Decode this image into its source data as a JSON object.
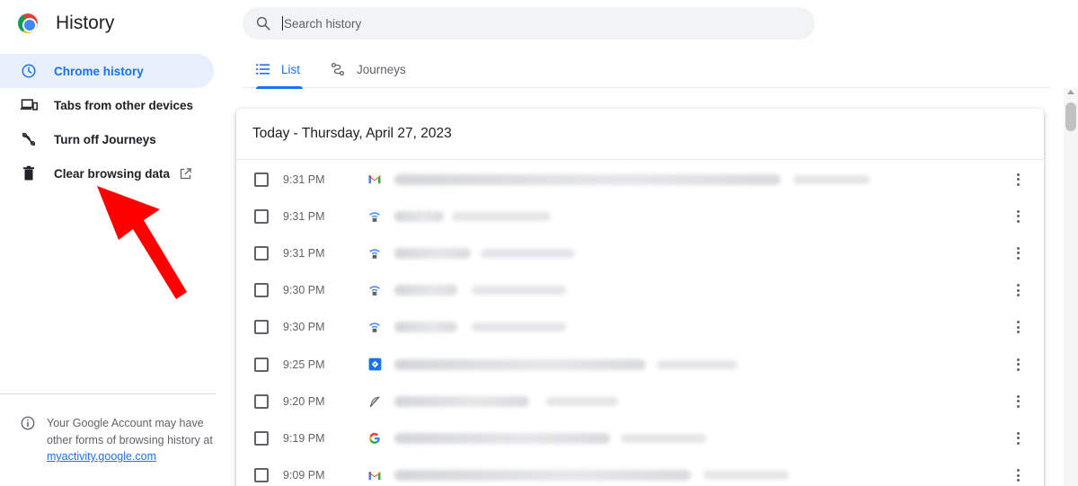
{
  "app": {
    "title": "History"
  },
  "sidebar": {
    "items": [
      {
        "label": "Chrome history",
        "icon": "clock-icon",
        "active": true
      },
      {
        "label": "Tabs from other devices",
        "icon": "devices-icon",
        "active": false
      },
      {
        "label": "Turn off Journeys",
        "icon": "journeys-off-icon",
        "active": false
      },
      {
        "label": "Clear browsing data",
        "icon": "trash-icon",
        "active": false,
        "external": true
      }
    ],
    "account_note": {
      "text": "Your Google Account may have other forms of browsing history at ",
      "link": "myactivity.google.com"
    }
  },
  "search": {
    "placeholder": "Search history"
  },
  "tabs": [
    {
      "label": "List",
      "active": true
    },
    {
      "label": "Journeys",
      "active": false
    }
  ],
  "history": {
    "date_header": "Today - Thursday, April 27, 2023",
    "rows": [
      {
        "time": "9:31 PM",
        "favicon": "gmail-icon"
      },
      {
        "time": "9:31 PM",
        "favicon": "lock-wifi-icon"
      },
      {
        "time": "9:31 PM",
        "favicon": "lock-wifi-icon"
      },
      {
        "time": "9:30 PM",
        "favicon": "lock-wifi-icon"
      },
      {
        "time": "9:30 PM",
        "favicon": "lock-wifi-icon"
      },
      {
        "time": "9:25 PM",
        "favicon": "blue-diamond-icon"
      },
      {
        "time": "9:20 PM",
        "favicon": "feather-icon"
      },
      {
        "time": "9:19 PM",
        "favicon": "google-icon"
      },
      {
        "time": "9:09 PM",
        "favicon": "gmail-icon"
      }
    ]
  },
  "colors": {
    "accent": "#1a73e8",
    "active_bg": "#e8f0fe",
    "annotation_arrow": "#ff0000"
  }
}
